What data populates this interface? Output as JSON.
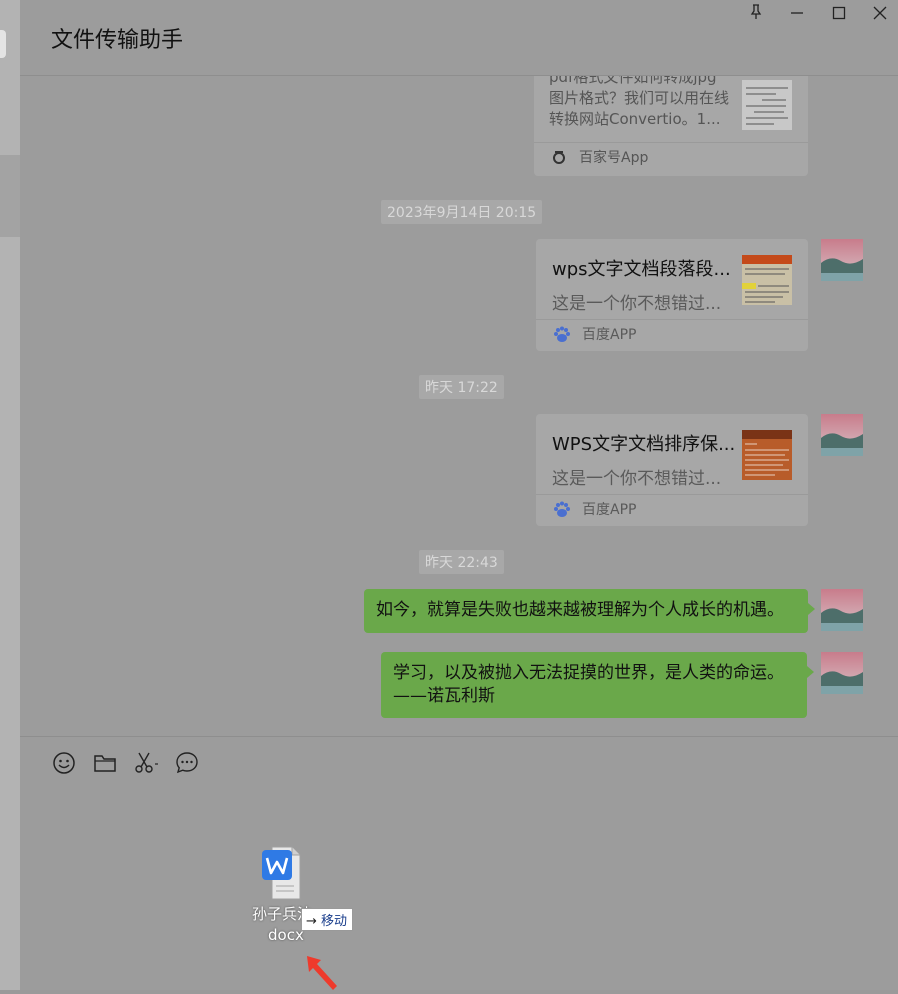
{
  "window": {
    "title": "文件传输助手",
    "controls": {
      "pin": "pin-icon",
      "minimize": "minimize-icon",
      "maximize": "maximize-icon",
      "close": "close-icon"
    }
  },
  "messages": {
    "card0": {
      "desc_line1": "pdf格式文件如何转成jpg",
      "desc_line2": "图片格式？我们可以用在线",
      "desc_line3": "转换网站Convertio。1...",
      "source": "百家号App"
    },
    "ts1": "2023年9月14日 20:15",
    "card1": {
      "title": "wps文字文档段落段...",
      "desc": "这是一个你不想错过...",
      "source": "百度APP"
    },
    "ts2": "昨天 17:22",
    "card2": {
      "title": "WPS文字文档排序保...",
      "desc": "这是一个你不想错过...",
      "source": "百度APP"
    },
    "ts3": "昨天 22:43",
    "text1": "如今，就算是失败也越来越被理解为个人成长的机遇。",
    "text2_line1": "学习，以及被抛入无法捉摸的世界，是人类的命运。",
    "text2_line2": "——诺瓦利斯"
  },
  "toolbar": {
    "emoji": "emoji-icon",
    "folder": "folder-icon",
    "screenshot": "scissors-icon",
    "chat": "chat-history-icon"
  },
  "drag": {
    "file_line1": "孙子兵法",
    "file_line2": "docx",
    "move_label": "移动"
  },
  "colors": {
    "bubble": "#6aa84a",
    "overlay": "#9c9c9c",
    "cursor": "#ee3a2c"
  }
}
